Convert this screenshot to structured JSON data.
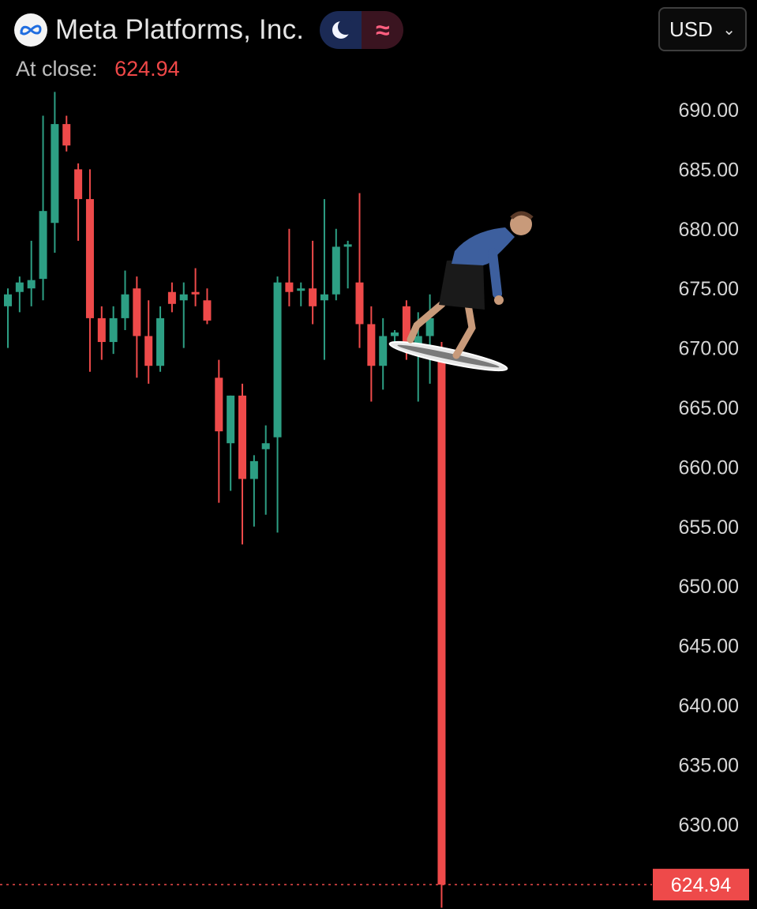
{
  "header": {
    "title": "Meta Platforms, Inc.",
    "close_label": "At close:",
    "close_value": "624.94",
    "currency": "USD",
    "logo_icon": "meta-infinity-icon",
    "theme_icon": "moon-icon",
    "waves_icon": "wavy-lines-icon"
  },
  "colors": {
    "up": "#2d9f84",
    "down": "#ee4a4a",
    "background": "#000000",
    "axis_text": "#d6d6d6",
    "price_label_bg": "#ee4a4a"
  },
  "chart_data": {
    "type": "candlestick",
    "y_axis_position": "right",
    "ylim": [
      623,
      693
    ],
    "y_ticks": [
      "690.00",
      "685.00",
      "680.00",
      "675.00",
      "670.00",
      "665.00",
      "660.00",
      "655.00",
      "650.00",
      "645.00",
      "640.00",
      "635.00",
      "630.00"
    ],
    "last_price_label": "624.94",
    "grid": false,
    "candles": [
      {
        "o": 673.5,
        "h": 675.0,
        "l": 670.0,
        "c": 674.5
      },
      {
        "o": 674.7,
        "h": 676.0,
        "l": 673.0,
        "c": 675.5
      },
      {
        "o": 675.0,
        "h": 679.0,
        "l": 673.5,
        "c": 675.7
      },
      {
        "o": 675.8,
        "h": 689.5,
        "l": 674.0,
        "c": 681.5
      },
      {
        "o": 680.5,
        "h": 691.5,
        "l": 678.0,
        "c": 688.8
      },
      {
        "o": 688.8,
        "h": 689.5,
        "l": 686.5,
        "c": 687.0
      },
      {
        "o": 685.0,
        "h": 685.5,
        "l": 679.0,
        "c": 682.5
      },
      {
        "o": 682.5,
        "h": 685.0,
        "l": 668.0,
        "c": 672.5
      },
      {
        "o": 672.5,
        "h": 673.5,
        "l": 669.0,
        "c": 670.5
      },
      {
        "o": 670.5,
        "h": 673.5,
        "l": 669.5,
        "c": 672.5
      },
      {
        "o": 672.5,
        "h": 676.5,
        "l": 671.5,
        "c": 674.5
      },
      {
        "o": 675.0,
        "h": 676.0,
        "l": 667.5,
        "c": 671.0
      },
      {
        "o": 671.0,
        "h": 674.0,
        "l": 667.0,
        "c": 668.5
      },
      {
        "o": 668.5,
        "h": 673.5,
        "l": 668.0,
        "c": 672.5
      },
      {
        "o": 674.7,
        "h": 675.5,
        "l": 673.0,
        "c": 673.7
      },
      {
        "o": 674.0,
        "h": 675.5,
        "l": 670.0,
        "c": 674.5
      },
      {
        "o": 674.7,
        "h": 676.7,
        "l": 673.5,
        "c": 674.5
      },
      {
        "o": 674.0,
        "h": 675.0,
        "l": 672.0,
        "c": 672.3
      },
      {
        "o": 667.5,
        "h": 669.0,
        "l": 657.0,
        "c": 663.0
      },
      {
        "o": 662.0,
        "h": 666.0,
        "l": 658.0,
        "c": 666.0
      },
      {
        "o": 666.0,
        "h": 667.0,
        "l": 653.5,
        "c": 659.0
      },
      {
        "o": 659.0,
        "h": 661.0,
        "l": 655.0,
        "c": 660.5
      },
      {
        "o": 661.5,
        "h": 663.5,
        "l": 656.0,
        "c": 662.0
      },
      {
        "o": 662.5,
        "h": 676.0,
        "l": 654.5,
        "c": 675.5
      },
      {
        "o": 675.5,
        "h": 680.0,
        "l": 673.5,
        "c": 674.7
      },
      {
        "o": 674.8,
        "h": 675.5,
        "l": 673.5,
        "c": 675.0
      },
      {
        "o": 675.0,
        "h": 679.0,
        "l": 672.0,
        "c": 673.5
      },
      {
        "o": 674.0,
        "h": 682.5,
        "l": 669.0,
        "c": 674.5
      },
      {
        "o": 674.5,
        "h": 680.0,
        "l": 674.0,
        "c": 678.5
      },
      {
        "o": 678.5,
        "h": 679.0,
        "l": 675.0,
        "c": 678.7
      },
      {
        "o": 675.5,
        "h": 683.0,
        "l": 670.0,
        "c": 672.0
      },
      {
        "o": 672.0,
        "h": 673.5,
        "l": 665.5,
        "c": 668.5
      },
      {
        "o": 668.5,
        "h": 672.5,
        "l": 666.5,
        "c": 671.0
      },
      {
        "o": 671.0,
        "h": 671.5,
        "l": 670.0,
        "c": 671.3
      },
      {
        "o": 673.5,
        "h": 674.0,
        "l": 669.0,
        "c": 670.5
      },
      {
        "o": 670.0,
        "h": 673.0,
        "l": 665.5,
        "c": 671.0
      },
      {
        "o": 671.0,
        "h": 674.5,
        "l": 667.0,
        "c": 672.5
      },
      {
        "o": 670.0,
        "h": 670.5,
        "l": 623.0,
        "c": 624.94
      }
    ]
  }
}
